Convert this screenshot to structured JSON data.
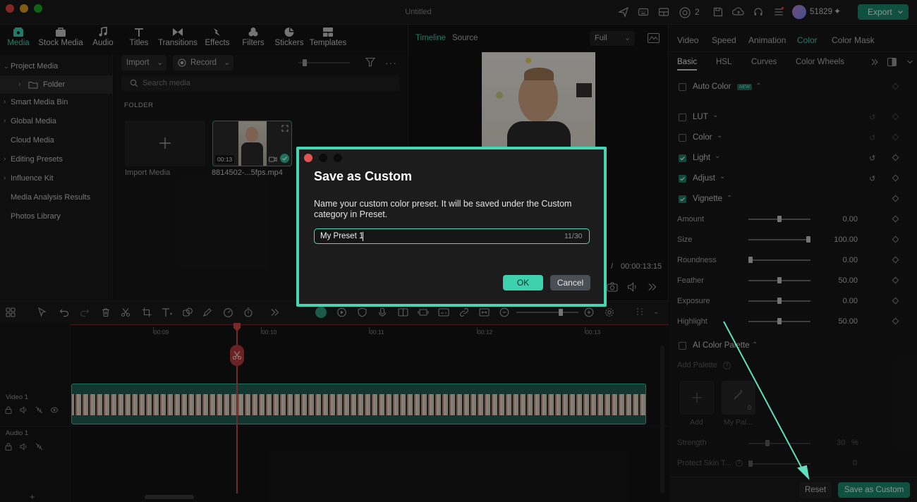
{
  "window": {
    "title": "Untitled",
    "credits": "51829",
    "export_label": "Export",
    "badge_count": "2"
  },
  "tools": [
    {
      "label": "Media",
      "icon": "media-icon"
    },
    {
      "label": "Stock Media",
      "icon": "stock-media-icon"
    },
    {
      "label": "Audio",
      "icon": "music-note-icon"
    },
    {
      "label": "Titles",
      "icon": "text-icon"
    },
    {
      "label": "Transitions",
      "icon": "transitions-icon"
    },
    {
      "label": "Effects",
      "icon": "effects-icon"
    },
    {
      "label": "Filters",
      "icon": "filters-icon"
    },
    {
      "label": "Stickers",
      "icon": "stickers-icon"
    },
    {
      "label": "Templates",
      "icon": "templates-icon"
    }
  ],
  "sidebar": {
    "items": [
      {
        "label": "Project Media"
      },
      {
        "label": "Folder"
      },
      {
        "label": "Smart Media Bin"
      },
      {
        "label": "Global Media"
      },
      {
        "label": "Cloud Media"
      },
      {
        "label": "Editing Presets"
      },
      {
        "label": "Influence Kit"
      },
      {
        "label": "Media Analysis Results"
      },
      {
        "label": "Photos Library"
      }
    ]
  },
  "media": {
    "import_label": "Import",
    "record_label": "Record",
    "search_placeholder": "Search media",
    "folder_heading": "FOLDER",
    "import_media_label": "Import Media",
    "clip_name": "8814502-...5fps.mp4",
    "clip_duration": "00:13"
  },
  "preview": {
    "tab_timeline": "Timeline",
    "tab_source": "Source",
    "zoom_value": "Full",
    "time_sep": "/",
    "total_time": "00:00:13:15"
  },
  "right": {
    "tabs": [
      "Video",
      "Speed",
      "Animation",
      "Color",
      "Color Mask"
    ],
    "subtabs": [
      "Basic",
      "HSL",
      "Curves",
      "Color Wheels"
    ],
    "auto_color": "Auto Color",
    "new_badge": "NEW",
    "sections": [
      "LUT",
      "Color",
      "Light",
      "Adjust",
      "Vignette"
    ],
    "vignette_params": [
      {
        "label": "Amount",
        "value": "0.00",
        "pos": 0.5
      },
      {
        "label": "Size",
        "value": "100.00",
        "pos": 1.0
      },
      {
        "label": "Roundness",
        "value": "0.00",
        "pos": 0.0
      },
      {
        "label": "Feather",
        "value": "50.00",
        "pos": 0.5
      },
      {
        "label": "Exposure",
        "value": "0.00",
        "pos": 0.5
      },
      {
        "label": "Highlight",
        "value": "50.00",
        "pos": 0.5
      }
    ],
    "ai_palette": "AI Color Palette",
    "add_palette": "Add Palette",
    "palette_add": "Add",
    "palette_mine": "My Pal...",
    "palette_count": "0",
    "strength_label": "Strength",
    "strength_value": "30",
    "strength_unit": "%",
    "protect_label": "Protect Skin T...",
    "protect_value": "0",
    "reset_label": "Reset",
    "save_custom_label": "Save as Custom"
  },
  "timeline": {
    "ticks": [
      "00:09",
      "00:10",
      "00:11",
      "00:12",
      "00:13"
    ],
    "video_track": "Video 1",
    "audio_track": "Audio 1"
  },
  "dialog": {
    "title": "Save as Custom",
    "description": "Name your custom color preset. It will be saved under the Custom category in Preset.",
    "input_value": "My Preset 1",
    "char_count": "11/30",
    "ok_label": "OK",
    "cancel_label": "Cancel"
  },
  "colors": {
    "accent": "#3ed1ad",
    "dialog_border": "#47d6b4",
    "arrow": "#5fe0bf"
  }
}
